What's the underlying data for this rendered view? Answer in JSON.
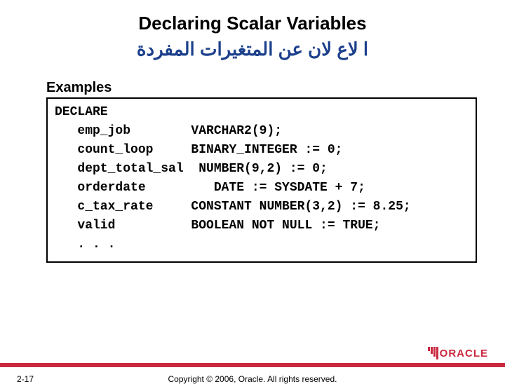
{
  "title": "Declaring Scalar Variables",
  "subtitle": "ا    لاع    لان عن المتغيرات المفردة",
  "examples_label": "Examples",
  "code": "DECLARE\n   emp_job        VARCHAR2(9);\n   count_loop     BINARY_INTEGER := 0;\n   dept_total_sal  NUMBER(9,2) := 0;\n   orderdate         DATE := SYSDATE + 7;\n   c_tax_rate     CONSTANT NUMBER(3,2) := 8.25;\n   valid          BOOLEAN NOT NULL := TRUE;\n   . . .",
  "page_number": "2-17",
  "copyright": "Copyright © 2006, Oracle. All rights reserved.",
  "logo_text": "ORACLE"
}
